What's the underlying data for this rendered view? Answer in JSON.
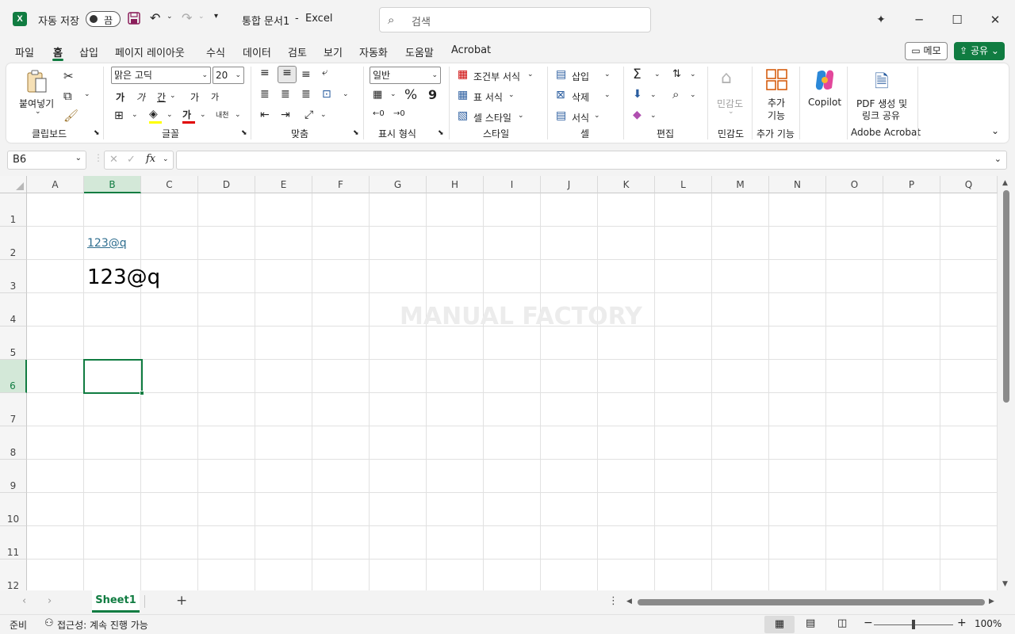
{
  "titlebar": {
    "autosave_label": "자동 저장",
    "autosave_state": "끔",
    "doc_title": "통합 문서1",
    "sep": "-",
    "app_name": "Excel",
    "search_placeholder": "검색"
  },
  "menu": {
    "tabs": [
      "파일",
      "홈",
      "삽입",
      "페이지 레이아웃",
      "수식",
      "데이터",
      "검토",
      "보기",
      "자동화",
      "도움말",
      "Acrobat"
    ],
    "memo_label": "메모",
    "share_label": "공유"
  },
  "ribbon": {
    "clipboard": {
      "paste": "붙여넣기",
      "group": "클립보드"
    },
    "font": {
      "name": "맑은 고딕",
      "size": "20",
      "bold": "가",
      "italic": "가",
      "underline": "간",
      "grow": "가",
      "shrink": "가",
      "group": "글꼴",
      "phonetic": "내천"
    },
    "align": {
      "group": "맞춤"
    },
    "number": {
      "format": "일반",
      "percent": "%",
      "comma": "9",
      "group": "표시 형식"
    },
    "styles": {
      "conditional": "조건부 서식",
      "table": "표 서식",
      "cell": "셀 스타일",
      "group": "스타일"
    },
    "cells": {
      "insert": "삽입",
      "delete": "삭제",
      "format": "서식",
      "group": "셀"
    },
    "edit": {
      "group": "편집"
    },
    "sensitivity": {
      "label": "민감도",
      "group": "민감도"
    },
    "addins": {
      "label1": "추가",
      "label2": "기능",
      "group": "추가 기능"
    },
    "copilot": {
      "label": "Copilot"
    },
    "acrobat": {
      "label1": "PDF 생성 및",
      "label2": "링크 공유",
      "group": "Adobe Acrobat"
    }
  },
  "formula": {
    "namebox": "B6",
    "fx": "fx",
    "value": ""
  },
  "grid": {
    "columns": [
      "A",
      "B",
      "C",
      "D",
      "E",
      "F",
      "G",
      "H",
      "I",
      "J",
      "K",
      "L",
      "M",
      "N",
      "O",
      "P",
      "Q"
    ],
    "rows": [
      "1",
      "2",
      "3",
      "4",
      "5",
      "6",
      "7",
      "8",
      "9",
      "10",
      "11",
      "12"
    ],
    "cell_b2": "123@q",
    "cell_b3": "123@q",
    "watermark": "MANUAL FACTORY"
  },
  "sheets": {
    "active": "Sheet1",
    "add": "+"
  },
  "status": {
    "ready": "준비",
    "accessibility": "접근성: 계속 진행 가능",
    "zoom": "100%"
  },
  "colors": {
    "accent": "#107c41",
    "link": "#2f6e8f"
  }
}
